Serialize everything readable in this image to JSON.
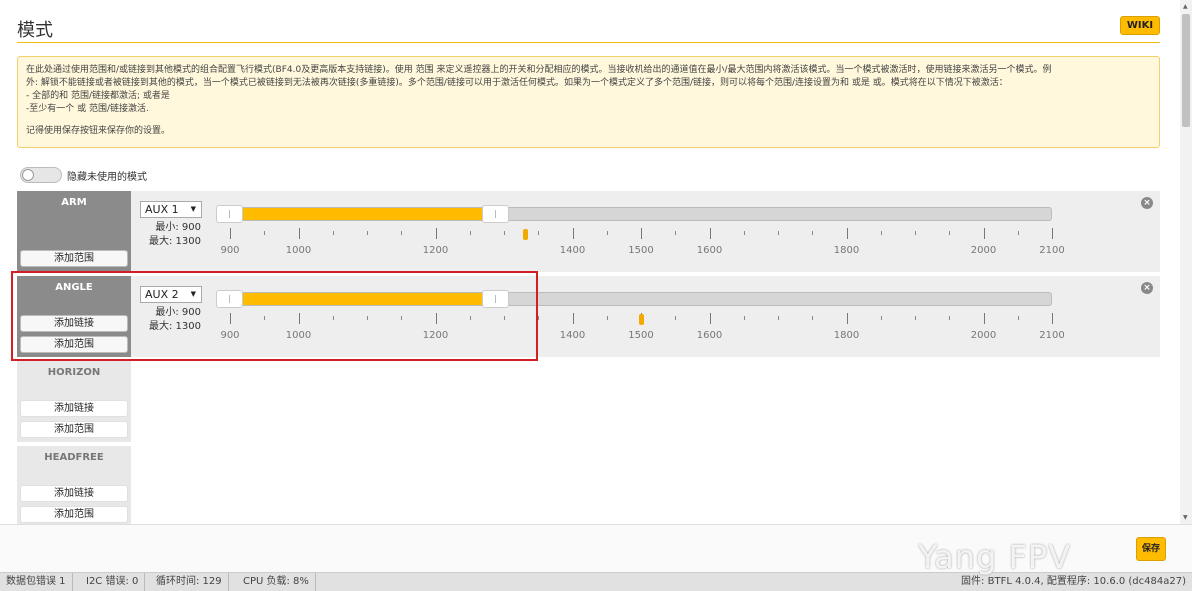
{
  "header": {
    "title": "模式",
    "wiki_label": "WIKI"
  },
  "note": {
    "lines": [
      "在此处通过使用范围和/或链接到其他模式的组合配置飞行模式(BF4.0及更高版本支持链接)。使用 范围 来定义遥控器上的开关和分配相应的模式。当接收机给出的通道值在最小/最大范围内将激活该模式。当一个模式被激活时，使用链接来激活另一个模式。例",
      "外: 解锁不能链接或者被链接到其他的模式，当一个模式已被链接到无法被再次链接(多重链接)。多个范围/链接可以用于激活任何模式。如果为一个模式定义了多个范围/链接，则可以将每个范围/连接设置为和 或是 或。模式将在以下情况下被激活：",
      "- 全部的和 范围/链接都激活; 或者是",
      "-至少有一个 或 范围/链接激活.",
      "记得使用保存按钮来保存你的设置。"
    ]
  },
  "toggle": {
    "label": "隐藏未使用的模式",
    "on": false
  },
  "buttons": {
    "add_link": "添加链接",
    "add_range": "添加范围"
  },
  "scale": {
    "min": 900,
    "max": 2100,
    "labels": [
      "900",
      "1000",
      "1200",
      "1400",
      "1500",
      "1600",
      "1800",
      "2000",
      "2100"
    ]
  },
  "modes": [
    {
      "name": "ARM",
      "channel": "AUX 1",
      "min_label": "最小: 900",
      "max_label": "最大: 1300",
      "range_min": 900,
      "range_max": 1300,
      "current": 1330,
      "active": true
    },
    {
      "name": "ANGLE",
      "channel": "AUX 2",
      "min_label": "最小: 900",
      "max_label": "最大: 1300",
      "range_min": 900,
      "range_max": 1300,
      "current": 1500,
      "active": true
    },
    {
      "name": "HORIZON",
      "active": false
    },
    {
      "name": "HEADFREE",
      "active": false
    }
  ],
  "footer": {
    "save_label": "保存"
  },
  "status_bar": {
    "packet_errors": "数据包错误 1",
    "i2c_errors": "I2C 错误: 0",
    "cycle_time": "循环时间: 129",
    "cpu_load": "CPU 负载: 8%",
    "firmware": "固件: BTFL 4.0.4, ",
    "configurator": "配置程序: 10.6.0 (dc484a27)"
  },
  "watermark": "Yang FPV",
  "colors": {
    "accent": "#ffbb00",
    "highlight": "#d21f26"
  }
}
